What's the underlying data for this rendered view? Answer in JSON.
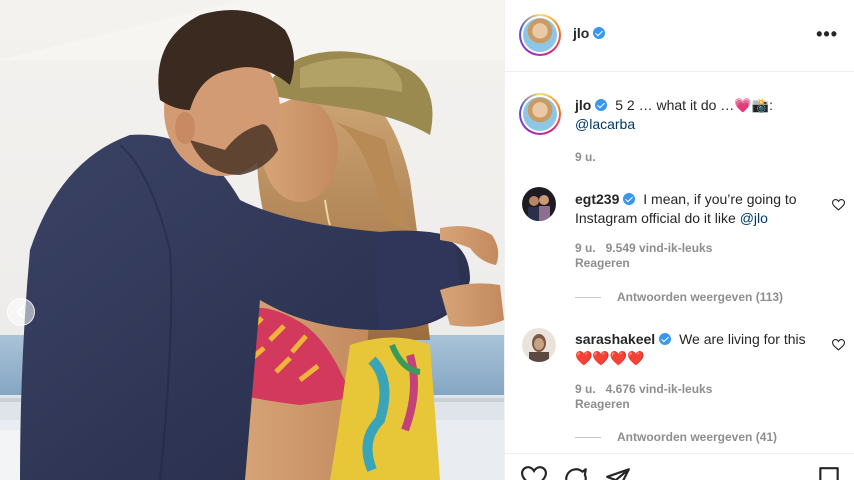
{
  "post": {
    "author": "jlo",
    "verified": true,
    "image_alt": "Couple kissing on a yacht deck by the sea"
  },
  "caption": {
    "username": "jlo",
    "text": "5 2 … what it do …💗📸:",
    "mention": "@lacarba",
    "time": "9 u."
  },
  "comments": [
    {
      "username": "egt239",
      "text": "I mean, if you’re going to Instagram official do it like",
      "mention": "@jlo",
      "time": "9 u.",
      "likes": "9.549 vind-ik-leuks",
      "reply_label": "Reageren",
      "view_replies": "Antwoorden weergeven (113)"
    },
    {
      "username": "sarashakeel",
      "text": "We are living for this ❤️❤️❤️❤️",
      "mention": "",
      "time": "9 u.",
      "likes": "4.676 vind-ik-leuks",
      "reply_label": "Reageren",
      "view_replies": "Antwoorden weergeven (41)"
    }
  ],
  "icons": {
    "more": "more-options-icon",
    "prev": "chevron-left-icon",
    "like": "heart-icon",
    "comment": "comment-icon",
    "share": "paper-plane-icon",
    "save": "bookmark-icon"
  },
  "colors": {
    "verified": "#3897f0",
    "mention": "#00376b",
    "muted": "#8e8e8e",
    "text": "#262626"
  },
  "labels": {
    "more": "•••"
  }
}
